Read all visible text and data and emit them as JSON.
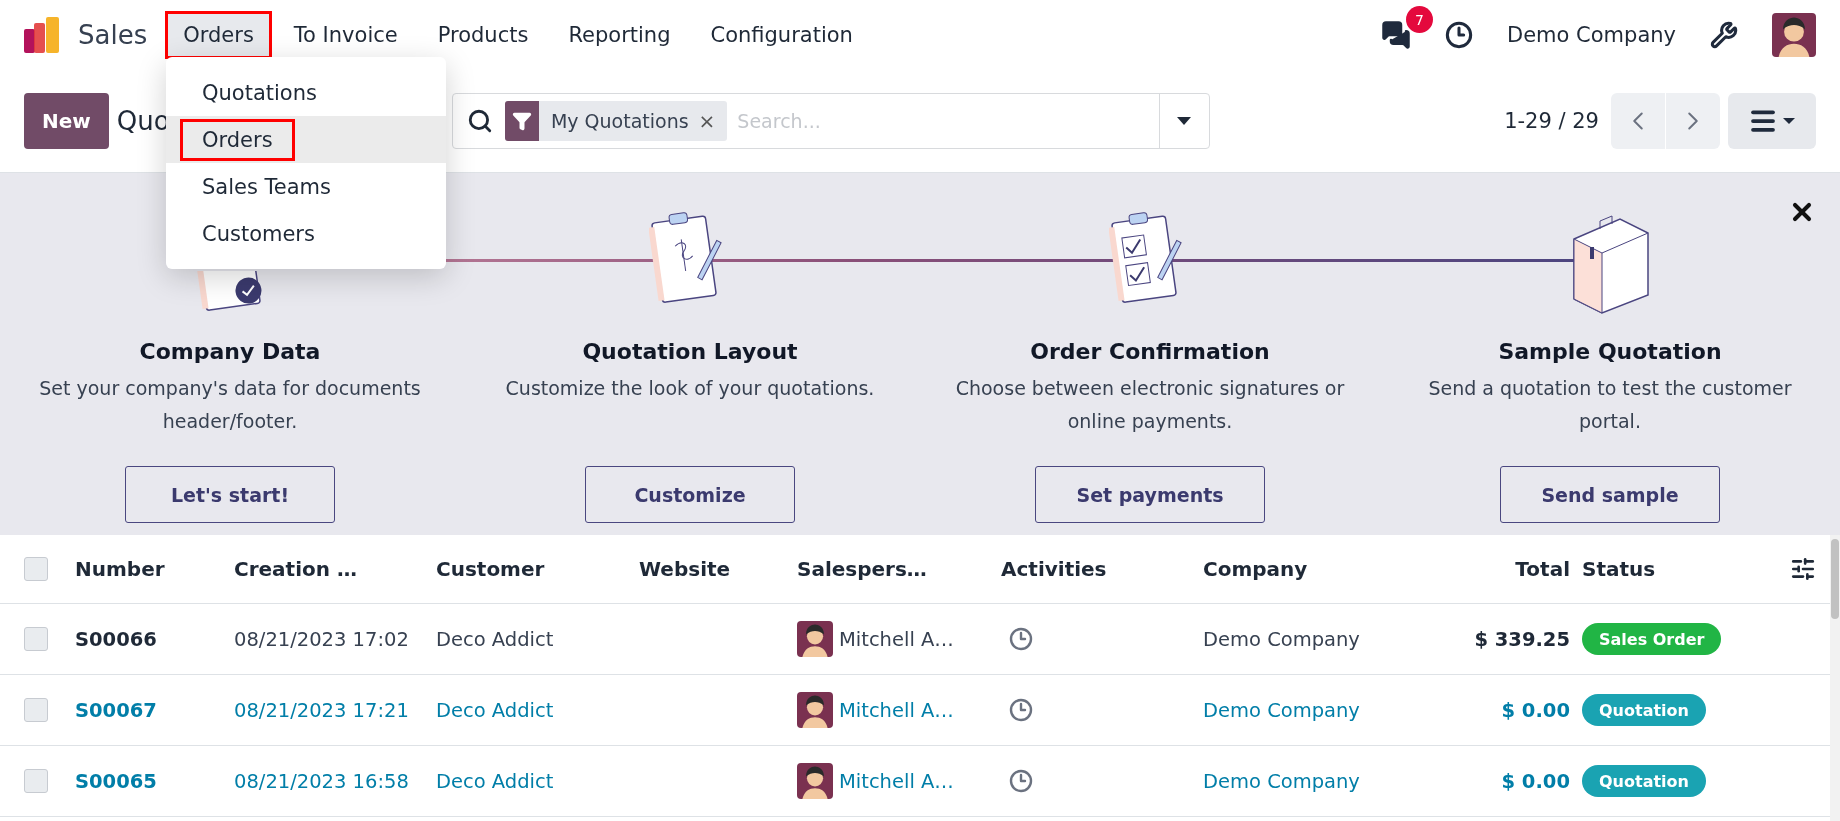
{
  "navbar": {
    "app_name": "Sales",
    "menu": [
      {
        "label": "Orders",
        "open": true,
        "highlighted": true
      },
      {
        "label": "To Invoice",
        "open": false,
        "highlighted": false
      },
      {
        "label": "Products",
        "open": false,
        "highlighted": false
      },
      {
        "label": "Reporting",
        "open": false,
        "highlighted": false
      },
      {
        "label": "Configuration",
        "open": false,
        "highlighted": false
      }
    ],
    "messages_badge": "7",
    "company": "Demo Company"
  },
  "orders_menu": {
    "items": [
      {
        "label": "Quotations",
        "selected": false,
        "highlighted": false
      },
      {
        "label": "Orders",
        "selected": true,
        "highlighted": true
      },
      {
        "label": "Sales Teams",
        "selected": false,
        "highlighted": false
      },
      {
        "label": "Customers",
        "selected": false,
        "highlighted": false
      }
    ]
  },
  "control_panel": {
    "new_button": "New",
    "title": "Quo",
    "search": {
      "facet": "My Quotations",
      "facet_remove": "×",
      "placeholder": "Search..."
    },
    "pager": "1-29 / 29"
  },
  "onboarding": {
    "steps": [
      {
        "kind": "company",
        "title": "Company Data",
        "description": "Set your company's data for documents header/footer.",
        "button": "Let's start!"
      },
      {
        "kind": "layout",
        "title": "Quotation Layout",
        "description": "Customize the look of your quotations.",
        "button": "Customize"
      },
      {
        "kind": "confirmation",
        "title": "Order Confirmation",
        "description": "Choose between electronic signatures or online payments.",
        "button": "Set payments"
      },
      {
        "kind": "sample",
        "title": "Sample Quotation",
        "description": "Send a quotation to test the customer portal.",
        "button": "Send sample"
      }
    ]
  },
  "table": {
    "select_all_checked": false,
    "columns": [
      {
        "label": "Number"
      },
      {
        "label": "Creation …"
      },
      {
        "label": "Customer"
      },
      {
        "label": "Website"
      },
      {
        "label": "Salespers…"
      },
      {
        "label": "Activities"
      },
      {
        "label": "Company"
      },
      {
        "label": "Total"
      },
      {
        "label": "Status"
      }
    ],
    "rows": [
      {
        "kind": "order",
        "checked": false,
        "number": "S00066",
        "creation": "08/21/2023 17:02",
        "customer": "Deco Addict",
        "salesperson": "Mitchell A…",
        "company": "Demo Company",
        "total": "$ 339.25",
        "status": {
          "label": "Sales Order",
          "color": "#21b545"
        }
      },
      {
        "kind": "quotation",
        "checked": false,
        "number": "S00067",
        "creation": "08/21/2023 17:21",
        "customer": "Deco Addict",
        "salesperson": "Mitchell A…",
        "company": "Demo Company",
        "total": "$ 0.00",
        "status": {
          "label": "Quotation",
          "color": "#1aa3b2"
        }
      },
      {
        "kind": "quotation",
        "checked": false,
        "number": "S00065",
        "creation": "08/21/2023 16:58",
        "customer": "Deco Addict",
        "salesperson": "Mitchell A…",
        "company": "Demo Company",
        "total": "$ 0.00",
        "status": {
          "label": "Quotation",
          "color": "#1aa3b2"
        }
      }
    ]
  }
}
